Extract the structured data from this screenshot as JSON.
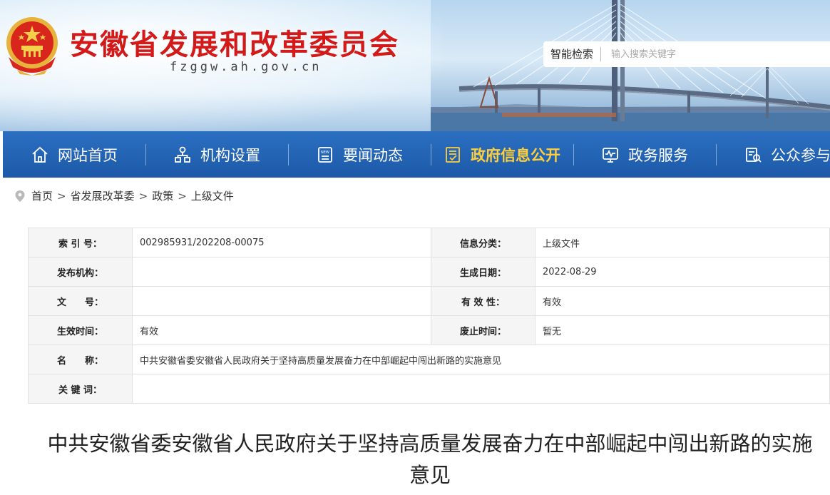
{
  "header": {
    "site_title": "安徽省发展和改革委员会",
    "domain": "fzggw.ah.gov.cn",
    "search": {
      "label": "智能检索",
      "placeholder": "输入搜索关键字"
    }
  },
  "nav": {
    "items": [
      {
        "label": "网站首页",
        "icon": "home-icon"
      },
      {
        "label": "机构设置",
        "icon": "org-chart-icon"
      },
      {
        "label": "要闻动态",
        "icon": "news-icon"
      },
      {
        "label": "政府信息公开",
        "icon": "info-disclosure-icon",
        "active": true
      },
      {
        "label": "政务服务",
        "icon": "service-monitor-icon"
      },
      {
        "label": "公众参与",
        "icon": "public-participation-icon"
      }
    ]
  },
  "breadcrumb": [
    "首页",
    "省发展改革委",
    "政策",
    "上级文件"
  ],
  "breadcrumb_sep": ">",
  "meta": {
    "index_no": {
      "label": "索 引 号：",
      "value": "002985931/202208-00075"
    },
    "category": {
      "label": "信息分类：",
      "value": "上级文件"
    },
    "publisher": {
      "label": "发布机构：",
      "value": ""
    },
    "date": {
      "label": "生成日期：",
      "value": "2022-08-29"
    },
    "doc_no": {
      "label": "文　　号：",
      "value": ""
    },
    "validity": {
      "label": "有 效 性：",
      "value": "有效"
    },
    "effective": {
      "label": "生效时间：",
      "value": "有效"
    },
    "abolish": {
      "label": "废止时间：",
      "value": "暂无"
    },
    "name": {
      "label": "名　　称：",
      "value": "中共安徽省委安徽省人民政府关于坚持高质量发展奋力在中部崛起中闯出新路的实施意见"
    },
    "keywords": {
      "label": "关 键 词：",
      "value": ""
    }
  },
  "article": {
    "title": "中共安徽省委安徽省人民政府关于坚持高质量发展奋力在中部崛起中闯出新路的实施意见"
  },
  "colors": {
    "title_red": "#d21a1a",
    "nav_blue": "#1d59a8",
    "nav_active": "#ffcf3a"
  }
}
